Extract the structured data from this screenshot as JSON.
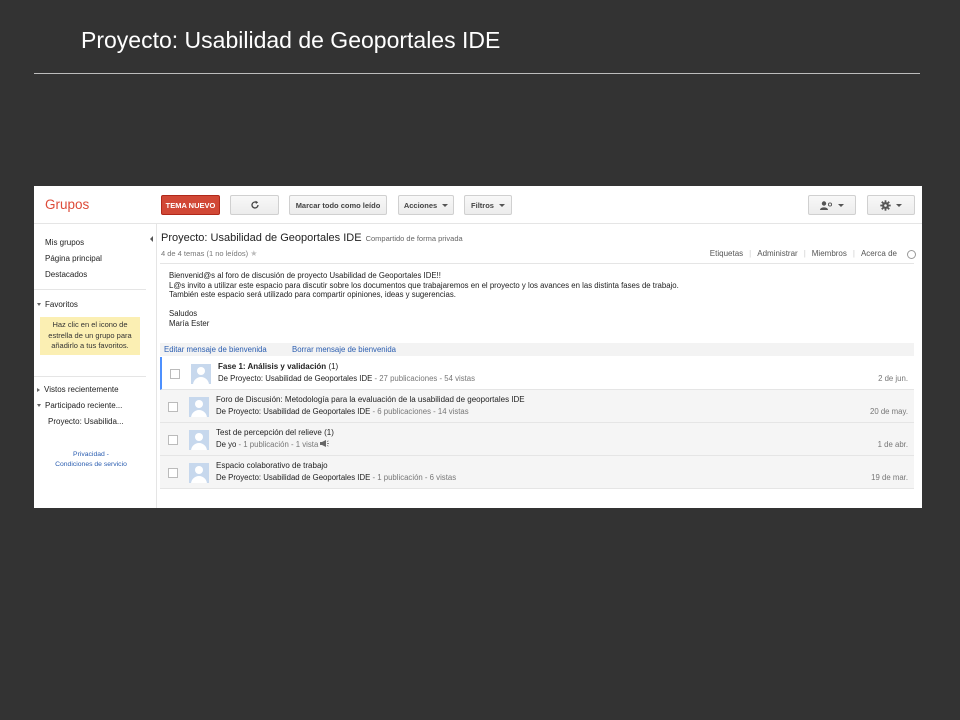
{
  "slide": {
    "title": "Proyecto: Usabilidad de Geoportales IDE"
  },
  "app": {
    "brand": "Grupos"
  },
  "toolbar": {
    "new_topic": "TEMA NUEVO",
    "refresh_icon": "refresh-icon",
    "mark_all_read": "Marcar todo como leído",
    "actions": "Acciones",
    "filters": "Filtros",
    "member_icon": "person-icon",
    "settings_icon": "gear-icon"
  },
  "sidebar": {
    "nav": [
      "Mis grupos",
      "Página principal",
      "Destacados"
    ],
    "favorites_header": "Favoritos",
    "favorites_hint": "Haz clic en el icono de estrella de un grupo para añadirlo a tus favoritos.",
    "recent_viewed": "Vistos recientemente",
    "recent_participated": "Participado reciente...",
    "recent_group": "Proyecto: Usabilida...",
    "privacy": "Privacidad -",
    "terms": "Condiciones de servicio"
  },
  "group": {
    "title": "Proyecto: Usabilidad de Geoportales IDE",
    "sharing": "Compartido de forma privada",
    "topic_count": "4 de 4 temas (1 no leídos)",
    "tabs": [
      "Etiquetas",
      "Administrar",
      "Miembros",
      "Acerca de"
    ]
  },
  "welcome": {
    "lines": [
      "Bienvenid@s al foro de discusión de proyecto Usabilidad de Geoportales IDE!!",
      "L@s invito a utilizar este espacio para discutir sobre los documentos que trabajaremos en el proyecto y los avances en las distinta fases de trabajo.",
      "También este espacio será utilizado para compartir opiniones, ideas y sugerencias.",
      "",
      "Saludos",
      "María Ester"
    ],
    "edit_link": "Editar mensaje de bienvenida",
    "delete_link": "Borrar mensaje de bienvenida"
  },
  "topics": [
    {
      "title": "Fase 1: Análisis y validación",
      "count": "(1)",
      "by": "De Proyecto: Usabilidad de Geoportales IDE",
      "stats": " - 27 publicaciones - 54 vistas",
      "date": "2 de jun.",
      "unread": true
    },
    {
      "title": "Foro de Discusión: Metodología para la evaluación de la usabilidad de geoportales IDE",
      "count": "",
      "by": "De Proyecto: Usabilidad de Geoportales IDE",
      "stats": " - 6 publicaciones - 14 vistas",
      "date": "20 de may.",
      "unread": false
    },
    {
      "title": "Test de percepción del relieve",
      "count": "(1)",
      "by": "De yo",
      "stats": " - 1 publicación - 1 vista",
      "date": "1 de abr.",
      "unread": false
    },
    {
      "title": "Espacio colaborativo de trabajo",
      "count": "",
      "by": "De Proyecto: Usabilidad de Geoportales IDE",
      "stats": " - 1 publicación - 6 vistas",
      "date": "19 de mar.",
      "unread": false
    }
  ]
}
